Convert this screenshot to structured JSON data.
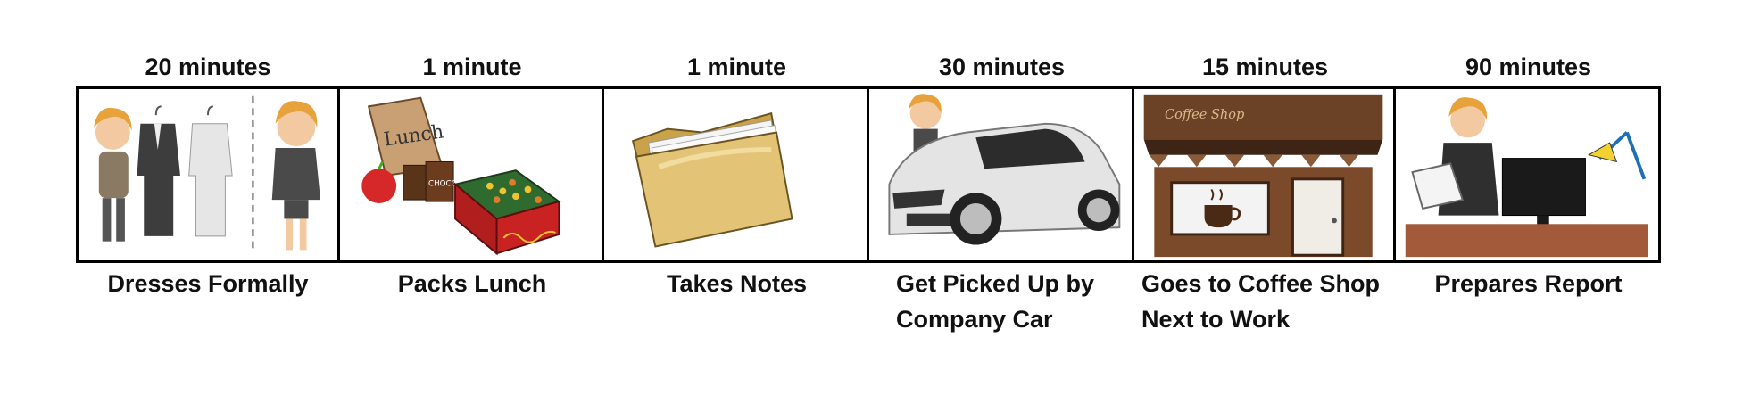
{
  "steps": [
    {
      "duration": "20 minutes",
      "caption": "Dresses Formally",
      "icon": "dressing-person-icon"
    },
    {
      "duration": "1 minute",
      "caption": "Packs Lunch",
      "icon": "lunch-bag-icon"
    },
    {
      "duration": "1 minute",
      "caption": "Takes Notes",
      "icon": "folder-icon"
    },
    {
      "duration": "30 minutes",
      "caption_lines": [
        "Get Picked Up by",
        "Company Car"
      ],
      "icon": "car-icon"
    },
    {
      "duration": "15 minutes",
      "caption_lines": [
        "Goes to Coffee Shop",
        "Next to Work"
      ],
      "icon": "coffee-shop-icon",
      "sign_text": "Coffee Shop"
    },
    {
      "duration": "90 minutes",
      "caption": "Prepares Report",
      "icon": "office-desk-icon"
    }
  ],
  "colors": {
    "border": "#000000",
    "text": "#111111",
    "hair": "#e8a23b",
    "shop_brown": "#6b4226",
    "folder": "#e3c477",
    "bag": "#c9a074"
  }
}
